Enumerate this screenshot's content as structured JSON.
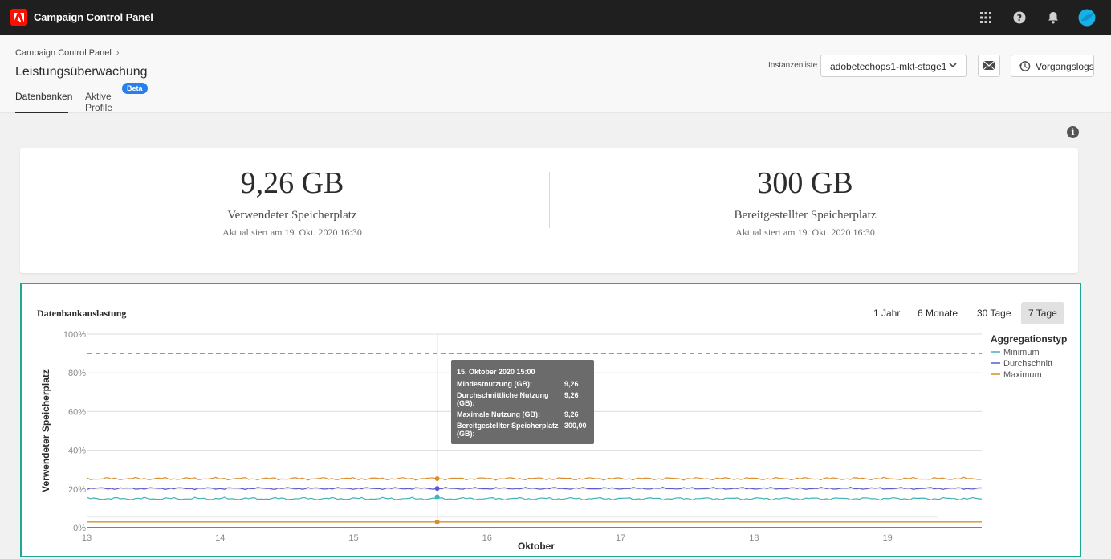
{
  "app": {
    "title": "Campaign Control Panel"
  },
  "breadcrumb": {
    "root": "Campaign Control Panel"
  },
  "page": {
    "title": "Leistungsüberwachung"
  },
  "tabs": [
    {
      "label": "Datenbanken",
      "active": true
    },
    {
      "label": "Aktive Profile",
      "active": false
    }
  ],
  "badge": {
    "beta": "Beta"
  },
  "instance": {
    "label": "Instanzenliste",
    "selected": "adobetechops1-mkt-stage1"
  },
  "logs": {
    "label": "Vorgangslogs"
  },
  "stats": [
    {
      "value": "9,26 GB",
      "label": "Verwendeter Speicherplatz",
      "updated": "Aktualisiert am 19. Okt. 2020 16:30"
    },
    {
      "value": "300 GB",
      "label": "Bereitgestellter Speicherplatz",
      "updated": "Aktualisiert am 19. Okt. 2020 16:30"
    }
  ],
  "chart_panel": {
    "title": "Datenbankauslastung",
    "ranges": [
      {
        "label": "1 Jahr"
      },
      {
        "label": "6 Monate"
      },
      {
        "label": "30 Tage"
      },
      {
        "label": "7 Tage",
        "active": true
      }
    ]
  },
  "tooltip": {
    "title": "15. Oktober 2020 15:00",
    "rows": [
      {
        "label": "Mindestnutzung (GB):",
        "value": "9,26"
      },
      {
        "label": "Durchschnittliche Nutzung (GB):",
        "value": "9,26"
      },
      {
        "label": "Maximale Nutzung (GB):",
        "value": "9,26"
      },
      {
        "label": "Bereitgestellter Speicherplatz (GB):",
        "value": "300,00"
      }
    ]
  },
  "colors": {
    "accent": "#1ea896",
    "minimum": "#40b3b8",
    "average": "#5c58d1",
    "maximum": "#d98f30",
    "threshold": "#e24a4a",
    "beta": "#2680eb"
  },
  "chart_data": {
    "type": "line",
    "xlabel": "Oktober",
    "ylabel": "Verwendeter Speicherplatz",
    "x_ticks": [
      "13",
      "14",
      "15",
      "16",
      "17",
      "18",
      "19"
    ],
    "xlim": [
      13,
      19.7
    ],
    "y_ticks": [
      "0%",
      "20%",
      "40%",
      "60%",
      "80%",
      "100%"
    ],
    "ylim": [
      0,
      100
    ],
    "grid": true,
    "legend": {
      "title": "Aggregationstyp",
      "position": "right"
    },
    "threshold": 90,
    "baseline": 3,
    "cursor_x": 15.62,
    "series": [
      {
        "name": "Minimum",
        "base": 15,
        "amp": 0.7
      },
      {
        "name": "Durchschnitt",
        "base": 20.3,
        "amp": 0.6
      },
      {
        "name": "Maximum",
        "base": 25.3,
        "amp": 0.7
      }
    ]
  }
}
